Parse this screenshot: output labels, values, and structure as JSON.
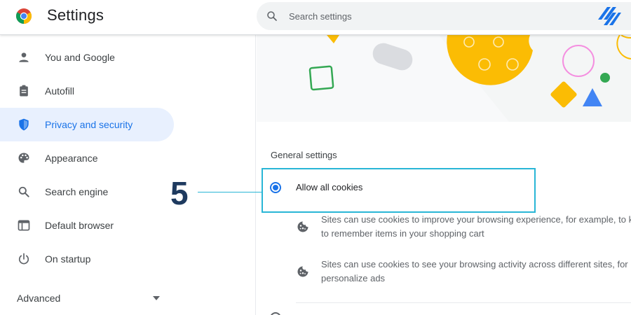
{
  "header": {
    "title": "Settings",
    "search_placeholder": "Search settings"
  },
  "sidebar": {
    "items": [
      {
        "label": "You and Google",
        "icon": "person-icon",
        "active": false
      },
      {
        "label": "Autofill",
        "icon": "clipboard-icon",
        "active": false
      },
      {
        "label": "Privacy and security",
        "icon": "shield-icon",
        "active": true
      },
      {
        "label": "Appearance",
        "icon": "palette-icon",
        "active": false
      },
      {
        "label": "Search engine",
        "icon": "search-icon",
        "active": false
      },
      {
        "label": "Default browser",
        "icon": "browser-window-icon",
        "active": false
      },
      {
        "label": "On startup",
        "icon": "power-icon",
        "active": false
      }
    ],
    "advanced_label": "Advanced"
  },
  "main": {
    "section_title": "General settings",
    "selected_option": "Allow all cookies",
    "bullets": [
      {
        "line1": "Sites can use cookies to improve your browsing experience, for example, to k",
        "line2": "to remember items in your shopping cart",
        "icon": "cookie-icon"
      },
      {
        "line1": "Sites can use cookies to see your browsing activity across different sites, for",
        "line2": "personalize ads",
        "icon": "cookie-icon"
      }
    ]
  },
  "overlay": {
    "step_number": "5"
  },
  "colors": {
    "accent": "#1a73e8",
    "active_bg": "#e8f0fe",
    "highlight": "#29b6d6",
    "step_number": "#1e3a5f",
    "banner_yellow": "#fbbc04",
    "banner_green": "#34a853"
  }
}
